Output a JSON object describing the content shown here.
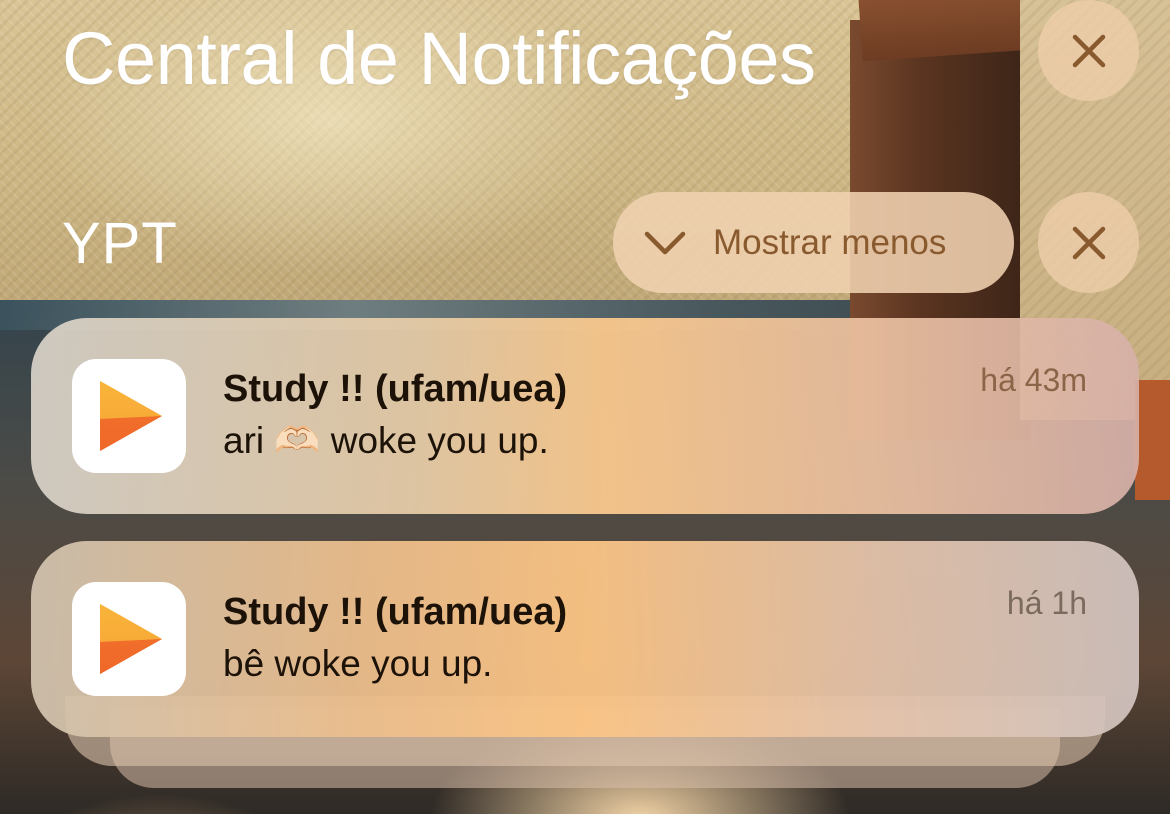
{
  "header": {
    "title": "Central de Notificações",
    "close_icon": "close-icon"
  },
  "group": {
    "name": "YPT",
    "show_less_label": "Mostrar menos",
    "show_less_icon": "chevron-down-icon",
    "close_icon": "close-icon"
  },
  "notifications": [
    {
      "app_icon": "play-icon",
      "title": "Study !! (ufam/uea)",
      "body": "ari 🫶🏻 woke you up.",
      "time": "há 43m"
    },
    {
      "app_icon": "play-icon",
      "title": "Study !! (ufam/uea)",
      "body": "bê  woke you up.",
      "time": "há 1h"
    }
  ],
  "colors": {
    "button_icon": "#8a5a2f",
    "app_icon_orange_top": "#f7b43a",
    "app_icon_orange_bottom": "#ef5a24"
  }
}
